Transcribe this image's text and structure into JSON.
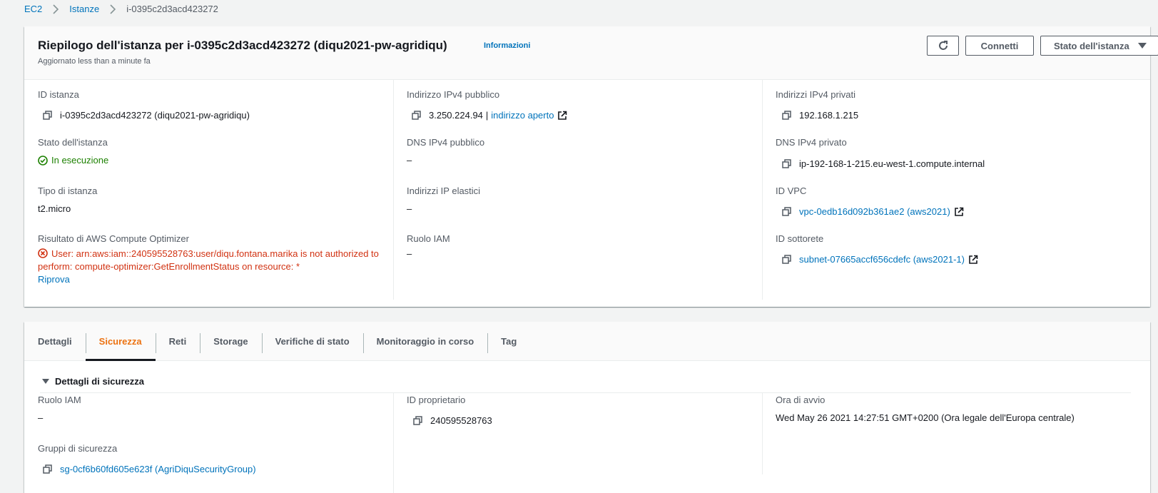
{
  "breadcrumb": {
    "items": [
      "EC2",
      "Istanze"
    ],
    "current": "i-0395c2d3acd423272"
  },
  "summary": {
    "title": "Riepilogo dell'istanza per i-0395c2d3acd423272 (diqu2021-pw-agridiqu)",
    "info": "Informazioni",
    "updated": "Aggiornato less than a minute fa",
    "buttons": {
      "refresh": "refresh-icon",
      "connect": "Connetti",
      "state": "Stato dell'istanza"
    },
    "fields": {
      "instance_id": {
        "label": "ID istanza",
        "value": "i-0395c2d3acd423272 (diqu2021-pw-agridiqu)"
      },
      "public_ipv4": {
        "label": "Indirizzo IPv4 pubblico",
        "value": "3.250.224.94",
        "sep": "|",
        "link": "indirizzo aperto"
      },
      "private_ipv4": {
        "label": "Indirizzi IPv4 privati",
        "value": "192.168.1.215"
      },
      "instance_state": {
        "label": "Stato dell'istanza",
        "value": "In esecuzione"
      },
      "public_dns": {
        "label": "DNS IPv4 pubblico",
        "value": "–"
      },
      "private_dns": {
        "label": "DNS IPv4 privato",
        "value": "ip-192-168-1-215.eu-west-1.compute.internal"
      },
      "instance_type": {
        "label": "Tipo di istanza",
        "value": "t2.micro"
      },
      "elastic_ip": {
        "label": "Indirizzi IP elastici",
        "value": "–"
      },
      "vpc_id": {
        "label": "ID VPC",
        "value": "vpc-0edb16d092b361ae2 (aws2021)"
      },
      "optimizer": {
        "label": "Risultato di AWS Compute Optimizer",
        "error": "User: arn:aws:iam::240595528763:user/diqu.fontana.marika is not authorized to perform: compute-optimizer:GetEnrollmentStatus on resource: *",
        "retry": "Riprova"
      },
      "iam_role": {
        "label": "Ruolo IAM",
        "value": "–"
      },
      "subnet_id": {
        "label": "ID sottorete",
        "value": "subnet-07665accf656cdefc (aws2021-1)"
      }
    }
  },
  "tabs": [
    {
      "label": "Dettagli"
    },
    {
      "label": "Sicurezza"
    },
    {
      "label": "Reti"
    },
    {
      "label": "Storage"
    },
    {
      "label": "Verifiche di stato"
    },
    {
      "label": "Monitoraggio in corso"
    },
    {
      "label": "Tag"
    }
  ],
  "active_tab": "Sicurezza",
  "security": {
    "heading": "Dettagli di sicurezza",
    "iam_role": {
      "label": "Ruolo IAM",
      "value": "–"
    },
    "owner_id": {
      "label": "ID proprietario",
      "value": "240595528763"
    },
    "launch_time": {
      "label": "Ora di avvio",
      "value": "Wed May 26 2021 14:27:51 GMT+0200 (Ora legale dell'Europa centrale)"
    },
    "security_groups": {
      "label": "Gruppi di sicurezza",
      "value": "sg-0cf6b60fd605e623f (AgriDiquSecurityGroup)"
    }
  },
  "colors": {
    "link": "#0073bb",
    "success": "#1d8102",
    "error": "#d13212",
    "active_tab": "#ec7211"
  }
}
